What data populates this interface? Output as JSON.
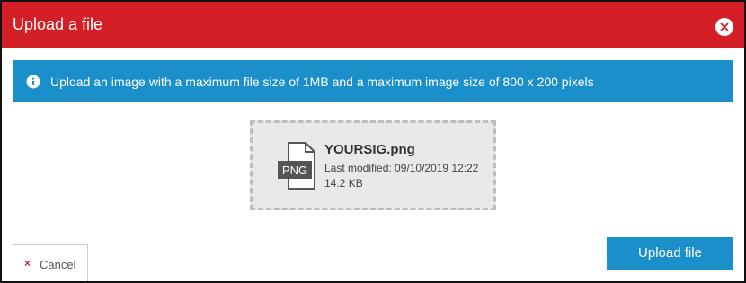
{
  "dialog": {
    "title": "Upload a file",
    "close_icon": "close-icon"
  },
  "info": {
    "icon": "info-icon",
    "text": "Upload an image with a maximum file size of 1MB and a maximum image size of 800 x 200 pixels"
  },
  "file": {
    "type_badge": "PNG",
    "name": "YOURSIG.png",
    "last_modified": "Last modified: 09/10/2019 12:22",
    "size": "14.2 KB"
  },
  "footer": {
    "cancel_icon": "×",
    "cancel_label": "Cancel",
    "upload_label": "Upload file"
  },
  "colors": {
    "header": "#d41f26",
    "accent_blue": "#1a8fc9",
    "drop_zone_bg": "#e9e9e9"
  }
}
